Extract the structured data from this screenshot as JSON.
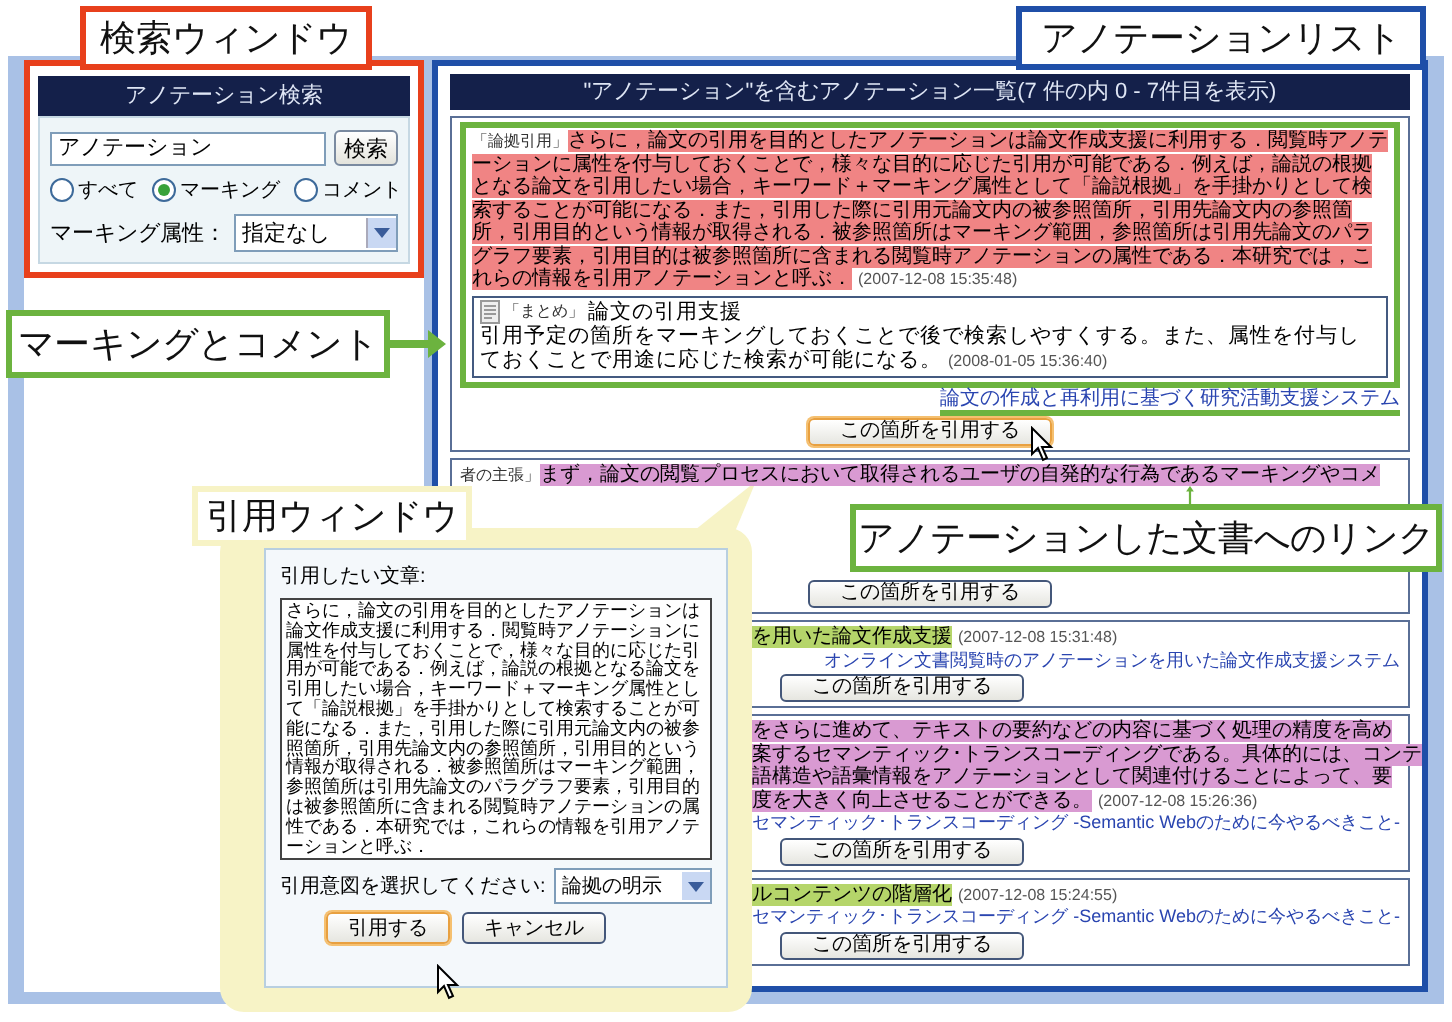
{
  "callouts": [
    {
      "text": "検索ウィンドウ",
      "color": "#e8401c"
    },
    {
      "text": "アノテーションリスト",
      "color": "#1f4fa8"
    },
    {
      "text": "マーキングとコメント",
      "color": "#6cb33f"
    },
    {
      "text": "引用ウィンドウ",
      "color": "#f7f3c6"
    },
    {
      "text": "アノテーションした文書へのリンク",
      "color": "#6cb33f"
    }
  ],
  "search_panel": {
    "title": "アノテーション検索",
    "query": "アノテーション",
    "search_button": "検索",
    "filters": [
      {
        "label": "すべて",
        "selected": false
      },
      {
        "label": "マーキング",
        "selected": true
      },
      {
        "label": "コメント",
        "selected": false
      }
    ],
    "attribute_label": "マーキング属性：",
    "attribute_value": "指定なし"
  },
  "result_list": {
    "title": "\"アノテーション\"を含むアノテーション一覧(7 件の内 0 - 7件目を表示)",
    "results": [
      {
        "tag": "「論拠引用」",
        "text": "さらに，論文の引用を目的としたアノテーションは論文作成支援に利用する．閲覧時アノテーションに属性を付与しておくことで，様々な目的に応じた引用が可能である．例えば，論説の根拠となる論文を引用したい場合，キーワード＋マーキング属性として「論説根拠」を手掛かりとして検索することが可能になる．また，引用した際に引用元論文内の被参照箇所，引用先論文内の参照箇所，引用目的という情報が取得される．被参照箇所はマーキング範囲，参照箇所は引用先論文のパラグラフ要素，引用目的は被参照箇所に含まれる閲覧時アノテーションの属性である．本研究では，これらの情報を引用アノテーションと呼ぶ．",
        "color": "#f08484",
        "timestamp": "(2007-12-08 15:35:48)",
        "comment": {
          "tag": "「まとめ」",
          "title": "論文の引用支援",
          "text": "引用予定の箇所をマーキングしておくことで後で検索しやすくする。また、属性を付与しておくことで用途に応じた検索が可能になる。",
          "timestamp": "(2008-01-05 15:36:40)"
        },
        "link": "論文の作成と再利用に基づく研究活動支援システム",
        "button": "この箇所を引用する"
      },
      {
        "tag": "者の主張」",
        "lines": [
          "まず，論文の閲覧プロセスにおいて取得されるユーザの自発的な行為であるマーキングやコメ"
        ],
        "color": "#d99ad2",
        "button": "この箇所を引用する"
      },
      {
        "lines": [
          "を用いた論文作成支援"
        ],
        "color": "#b5d56a",
        "timestamp": "(2007-12-08 15:31:48)",
        "link": "オンライン文書閲覧時のアノテーションを用いた論文作成支援システム",
        "button": "この箇所を引用する"
      },
      {
        "lines": [
          "をさらに進めて、テキストの要約などの内容に基づく処理の精度を高め",
          "案するセマンティック･トランスコーディングである。具体的には、コンテ",
          "語構造や語彙情報をアノテーションとして関連付けることによって、要",
          "度を大きく向上させることができる。"
        ],
        "color": "#d99ad2",
        "timestamp": "(2007-12-08 15:26:36)",
        "link": "セマンティック･トランスコーディング -Semantic Webのために今やるべきこと-",
        "button": "この箇所を引用する"
      },
      {
        "lines": [
          "ルコンテンツの階層化"
        ],
        "color": "#b5d56a",
        "timestamp": "(2007-12-08 15:24:55)",
        "link": "セマンティック･トランスコーディング -Semantic Webのために今やるべきこと-",
        "button": "この箇所を引用する"
      }
    ]
  },
  "quote_window": {
    "label": "引用したい文章:",
    "text": "さらに，論文の引用を目的としたアノテーションは論文作成支援に利用する．閲覧時アノテーションに属性を付与しておくことで，様々な目的に応じた引用が可能である．例えば，論説の根拠となる論文を引用したい場合，キーワード＋マーキング属性として「論説根拠」を手掛かりとして検索することが可能になる．また，引用した際に引用元論文内の被参照箇所，引用先論文内の参照箇所，引用目的という情報が取得される．被参照箇所はマーキング範囲，参照箇所は引用先論文のパラグラフ要素，引用目的は被参照箇所に含まれる閲覧時アノテーションの属性である．本研究では，これらの情報を引用アノテーションと呼ぶ．",
    "intent_label": "引用意図を選択してください:",
    "intent_value": "論拠の明示",
    "buttons": [
      {
        "label": "引用する",
        "focused": true
      },
      {
        "label": "キャンセル",
        "focused": false
      }
    ]
  }
}
